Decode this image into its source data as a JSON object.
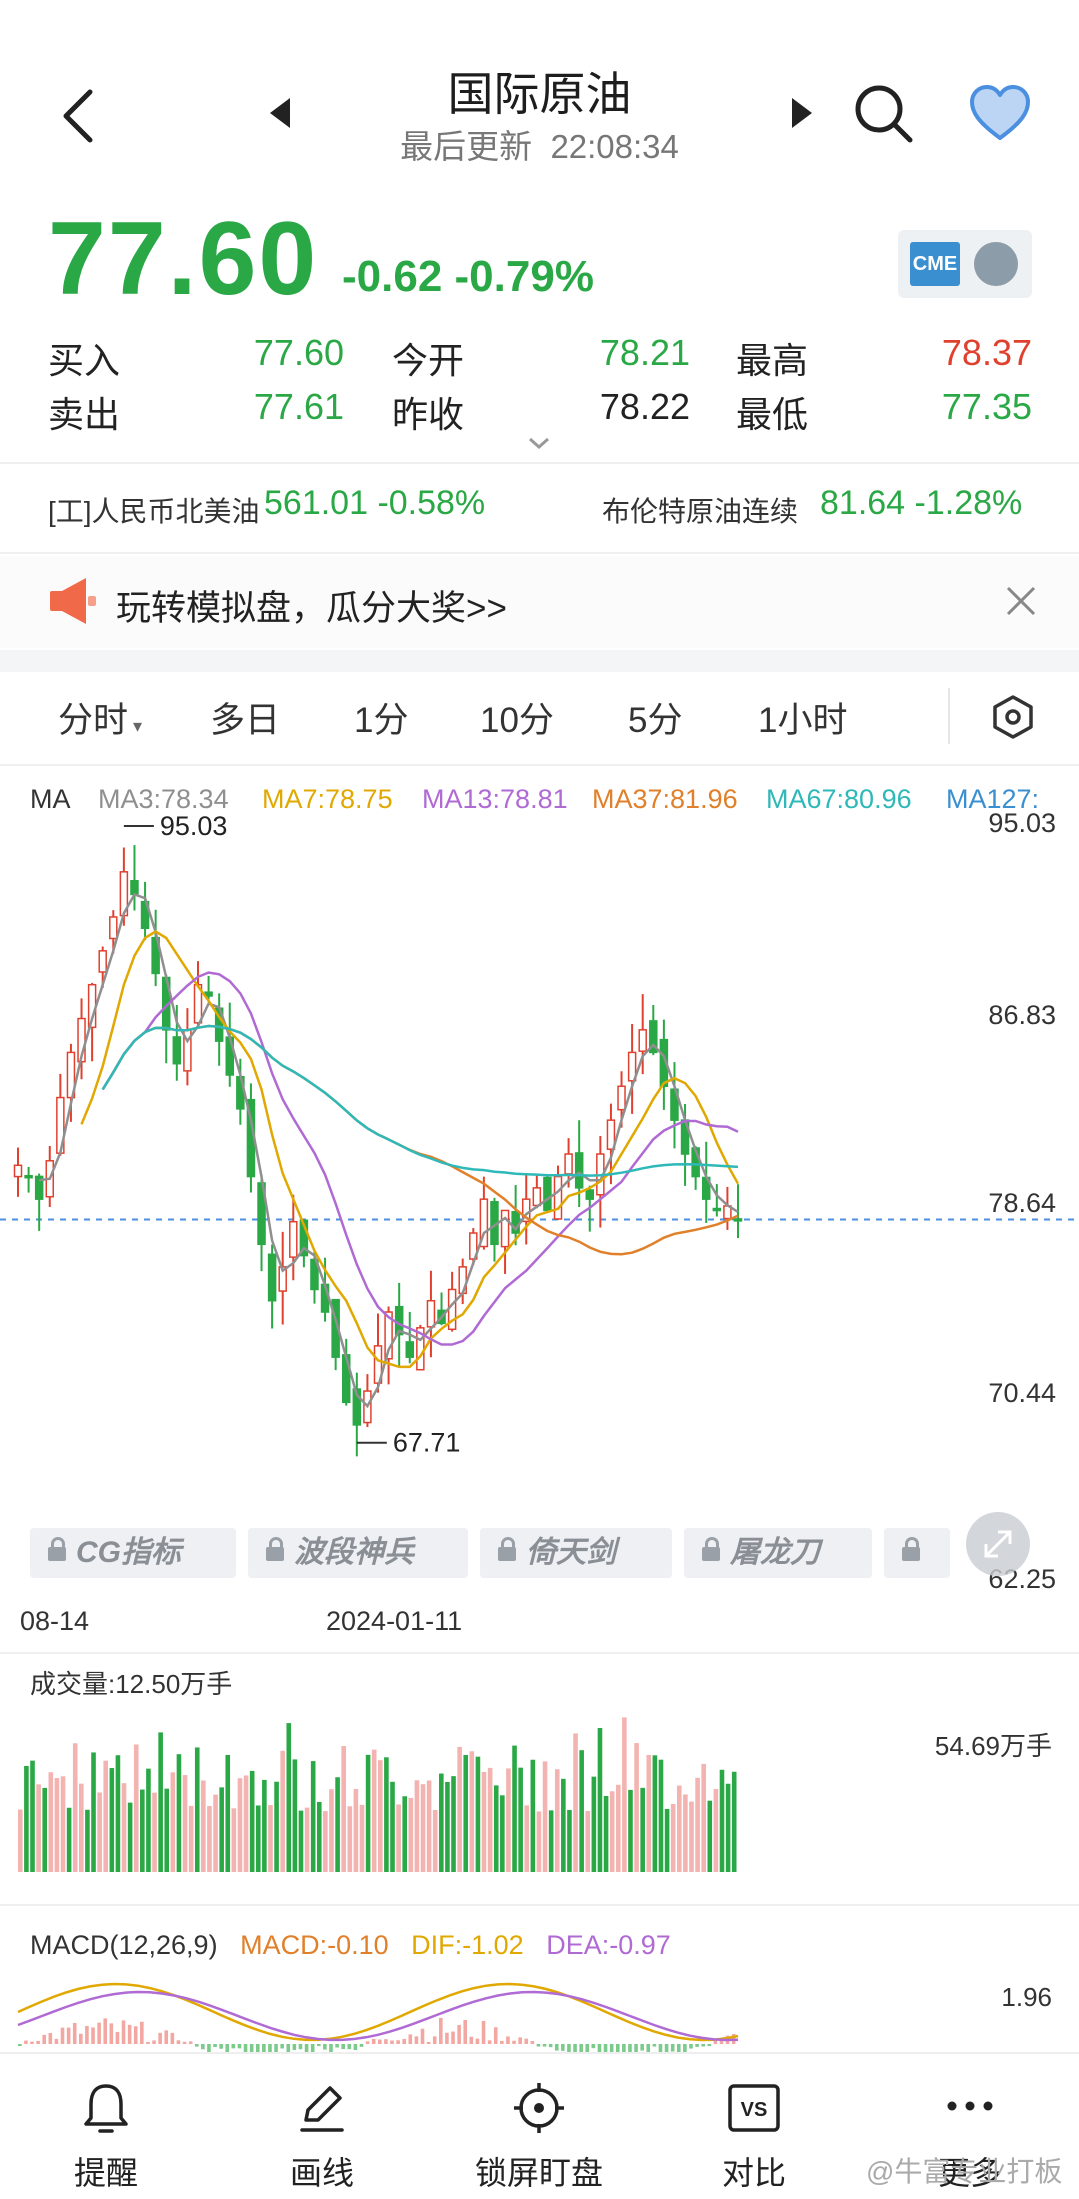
{
  "header": {
    "title": "国际原油",
    "updated_label": "最后更新",
    "updated_time": "22:08:34",
    "icons": [
      "back-arrow-icon",
      "previous-icon",
      "next-icon",
      "search-icon",
      "heart-icon"
    ]
  },
  "quote": {
    "price": "77.60",
    "change": "-0.62",
    "change_pct": "-0.79%",
    "exchange_logo": "CME",
    "rows": [
      {
        "label": "买入",
        "value": "77.60",
        "color": "green"
      },
      {
        "label": "卖出",
        "value": "77.61",
        "color": "green"
      },
      {
        "label": "今开",
        "value": "78.21",
        "color": "green"
      },
      {
        "label": "昨收",
        "value": "78.22",
        "color": "dark"
      },
      {
        "label": "最高",
        "value": "78.37",
        "color": "red"
      },
      {
        "label": "最低",
        "value": "77.35",
        "color": "green"
      }
    ]
  },
  "related": [
    {
      "label": "[工]人民币北美油",
      "value": "561.01 -0.58%"
    },
    {
      "label": "布伦特原油连续",
      "value": "81.64 -1.28%"
    }
  ],
  "promo": {
    "text": "玩转模拟盘，瓜分大奖>>"
  },
  "tabs": [
    {
      "label": "分时",
      "has_caret": true
    },
    {
      "label": "多日"
    },
    {
      "label": "1分"
    },
    {
      "label": "10分"
    },
    {
      "label": "5分"
    },
    {
      "label": "1小时"
    }
  ],
  "ma": {
    "label": "MA",
    "items": [
      {
        "text": "MA3:78.34",
        "color": "#8f8f8f"
      },
      {
        "text": "MA7:78.75",
        "color": "#e0a800"
      },
      {
        "text": "MA13:78.81",
        "color": "#b06ad4"
      },
      {
        "text": "MA37:81.96",
        "color": "#e0802a"
      },
      {
        "text": "MA67:80.96",
        "color": "#2fb8b8"
      },
      {
        "text": "MA127:",
        "color": "#3a8fd0"
      }
    ]
  },
  "price_axis": [
    "95.03",
    "86.83",
    "78.64",
    "70.44",
    "62.25"
  ],
  "annotations": {
    "high": "95.03",
    "low": "67.71"
  },
  "indicator_buttons": [
    "CG指标",
    "波段神兵",
    "倚天剑",
    "屠龙刀"
  ],
  "date_axis": [
    "08-14",
    "2024-01-11"
  ],
  "volume": {
    "title": "成交量:12.50万手",
    "max_label": "54.69万手"
  },
  "macd": {
    "title": "MACD(12,26,9)",
    "macd": "MACD:-0.10",
    "dif": "DIF:-1.02",
    "dea": "DEA:-0.97",
    "axis_top": "1.96"
  },
  "bottom_nav": [
    {
      "label": "提醒",
      "icon": "bell-icon"
    },
    {
      "label": "画线",
      "icon": "pen-icon"
    },
    {
      "label": "锁屏盯盘",
      "icon": "target-icon"
    },
    {
      "label": "对比",
      "icon": "vs-icon"
    },
    {
      "label": "更多",
      "icon": "more-icon"
    }
  ],
  "watermark": "@牛富专业打板",
  "colors": {
    "green": "#2aa846",
    "red": "#e0412f",
    "accent_blue": "#4a8fe0"
  },
  "chart_data": {
    "type": "candlestick",
    "y_range": [
      62.25,
      95.03
    ],
    "high_mark": 95.03,
    "low_mark": 67.71,
    "last_price": 77.6,
    "x_labels": [
      "08-14",
      "2024-01-11"
    ],
    "closes": [
      80.0,
      79.5,
      78.5,
      80.2,
      83.0,
      85.0,
      86.5,
      88.0,
      89.5,
      91.0,
      93.0,
      92.0,
      90.5,
      88.5,
      86.0,
      84.5,
      86.0,
      88.0,
      87.5,
      85.5,
      84.0,
      82.5,
      79.5,
      76.5,
      74.0,
      75.5,
      77.5,
      76.0,
      74.5,
      73.5,
      71.5,
      69.5,
      68.5,
      70.0,
      72.0,
      73.5,
      72.5,
      71.5,
      72.8,
      74.0,
      73.0,
      74.5,
      75.5,
      77.0,
      78.5,
      76.5,
      78.0,
      77.0,
      78.5,
      79.0,
      78.0,
      79.5,
      80.5,
      79.0,
      78.5,
      80.5,
      82.0,
      83.5,
      85.0,
      86.0,
      85.0,
      83.5,
      82.0,
      80.5,
      79.5,
      78.5,
      78.0,
      78.2,
      77.6
    ],
    "volume_scale_max": 54.69,
    "macd_axis_top": 1.96
  }
}
